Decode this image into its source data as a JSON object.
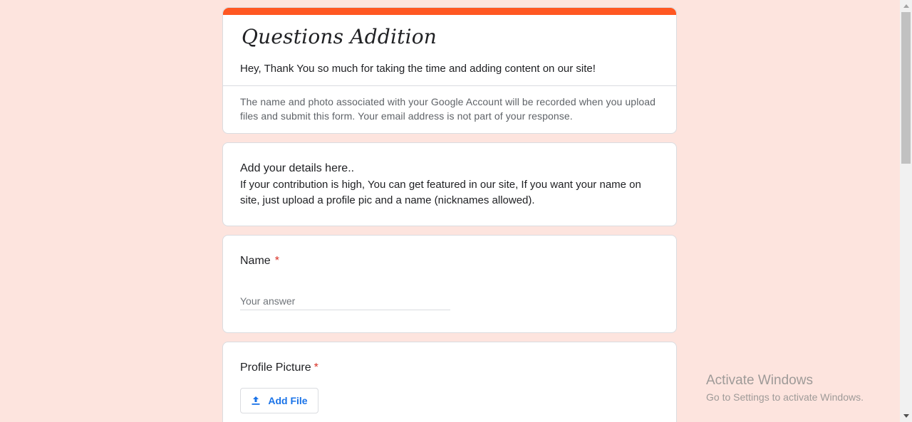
{
  "header": {
    "title": "Questions Addition",
    "description": "Hey, Thank You so much for taking the time and adding content on our site!",
    "account_note": "The name and photo associated with your Google Account will be recorded when you upload files and submit this form. Your email address is not part of your response."
  },
  "details_section": {
    "title": "Add your details here..",
    "body": "If your contribution is high, You can get featured in our site, If you want your name on site, just upload a profile pic and a name (nicknames allowed)."
  },
  "questions": {
    "name": {
      "label": "Name",
      "required_mark": "*",
      "placeholder": "Your answer"
    },
    "profile_picture": {
      "label": "Profile Picture",
      "required_mark": "*",
      "button_label": "Add File"
    }
  },
  "watermark": {
    "title": "Activate Windows",
    "subtitle": "Go to Settings to activate Windows."
  },
  "colors": {
    "background": "#fde4de",
    "accent_bar": "#ff5722",
    "required": "#d93025",
    "link_blue": "#1a73e8"
  }
}
